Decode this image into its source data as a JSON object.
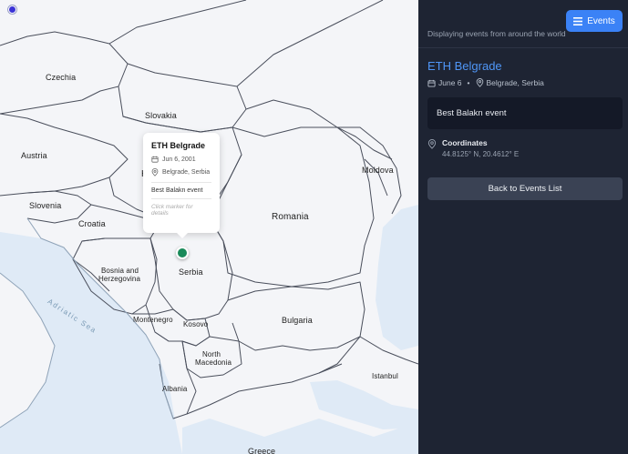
{
  "map": {
    "countries": [
      {
        "name": "Czechia"
      },
      {
        "name": "Slovakia"
      },
      {
        "name": "Austria"
      },
      {
        "name": "H"
      },
      {
        "name": "Slovenia"
      },
      {
        "name": "Croatia"
      },
      {
        "name": "Romania"
      },
      {
        "name": "Moldova"
      },
      {
        "name": "Serbia"
      },
      {
        "name": "Bosnia and"
      },
      {
        "name": "Herzegovina"
      },
      {
        "name": "Montenegro"
      },
      {
        "name": "Kosovo"
      },
      {
        "name": "Bulgaria"
      },
      {
        "name": "North"
      },
      {
        "name": "Macedonia"
      },
      {
        "name": "Albania"
      },
      {
        "name": "Istanbul"
      },
      {
        "name": "Greece"
      }
    ],
    "sea_label": "Adriatic Sea",
    "popup": {
      "title": "ETH Belgrade",
      "date": "Jun 6, 2001",
      "location": "Belgrade, Serbia",
      "description": "Best Balakn event",
      "hint": "Click marker for details"
    }
  },
  "sidebar": {
    "events_button": "Events",
    "subtitle": "Displaying events from around the world",
    "event": {
      "title": "ETH Belgrade",
      "date": "June 6",
      "separator": "•",
      "location": "Belgrade, Serbia",
      "description": "Best Balakn event",
      "coordinates_label": "Coordinates",
      "coordinates_value": "44.8125° N, 20.4612° E"
    },
    "back_button": "Back to Events List"
  },
  "colors": {
    "sidebar_bg": "#1e2433",
    "accent": "#3b82f6",
    "title_blue": "#4f96f7",
    "marker_green": "#1a8a5a",
    "water": "#dde9f6",
    "land": "#f4f5f8"
  }
}
